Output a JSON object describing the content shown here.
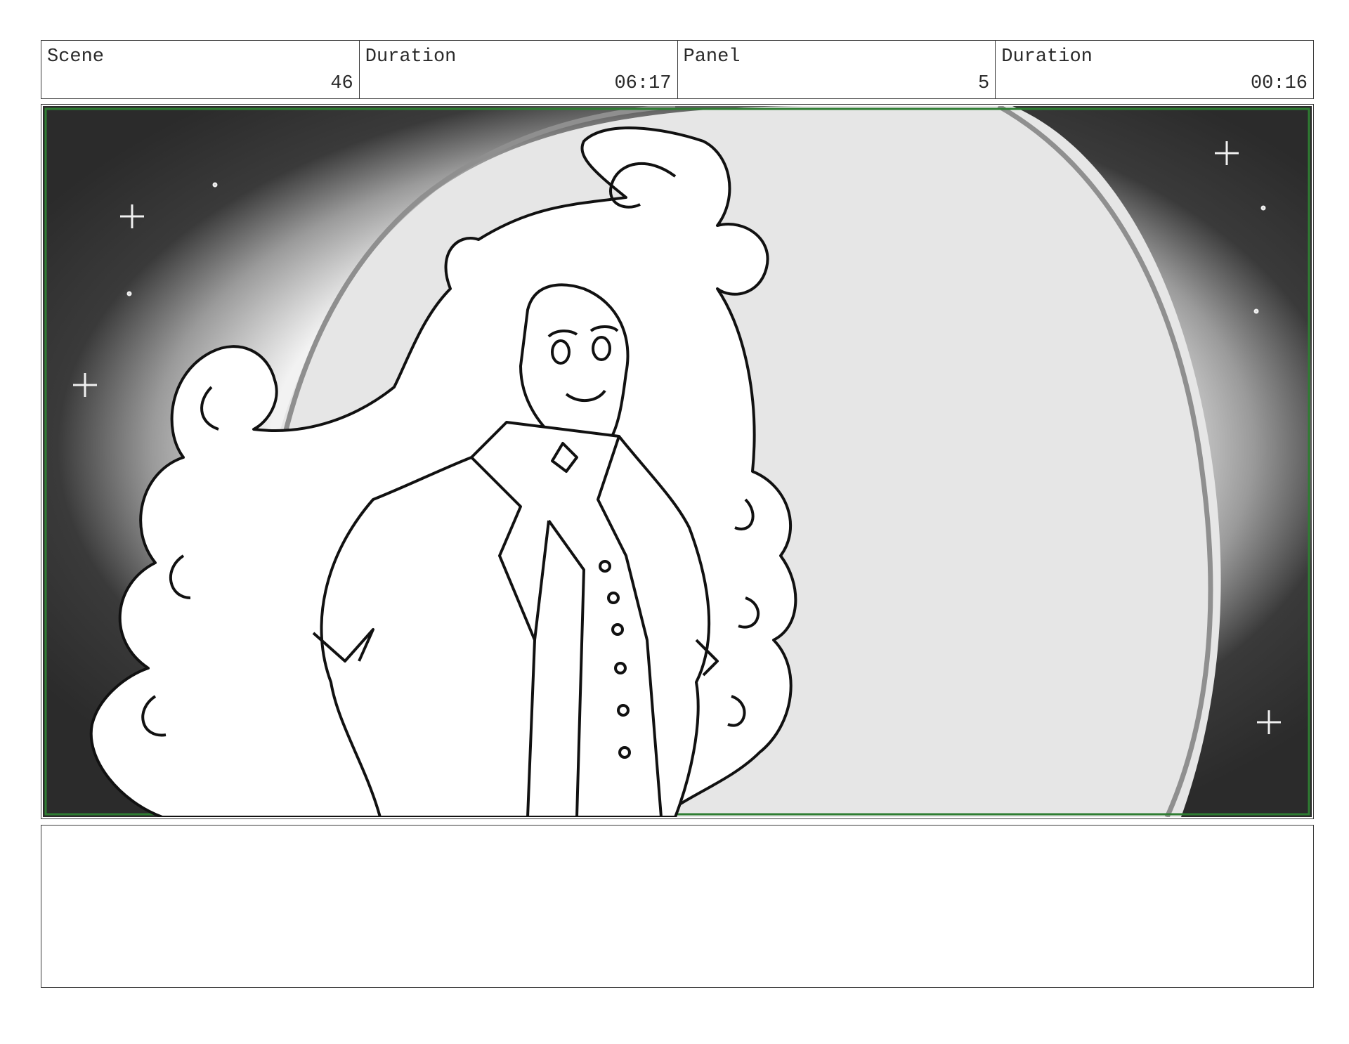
{
  "header": {
    "scene_label": "Scene",
    "scene_value": "46",
    "scene_duration_label": "Duration",
    "scene_duration_value": "06:17",
    "panel_label": "Panel",
    "panel_value": "5",
    "panel_duration_label": "Duration",
    "panel_duration_value": "00:16"
  },
  "panel": {
    "description": "",
    "safe_frame_color": "#2e7d32"
  },
  "notes": {
    "text": ""
  }
}
